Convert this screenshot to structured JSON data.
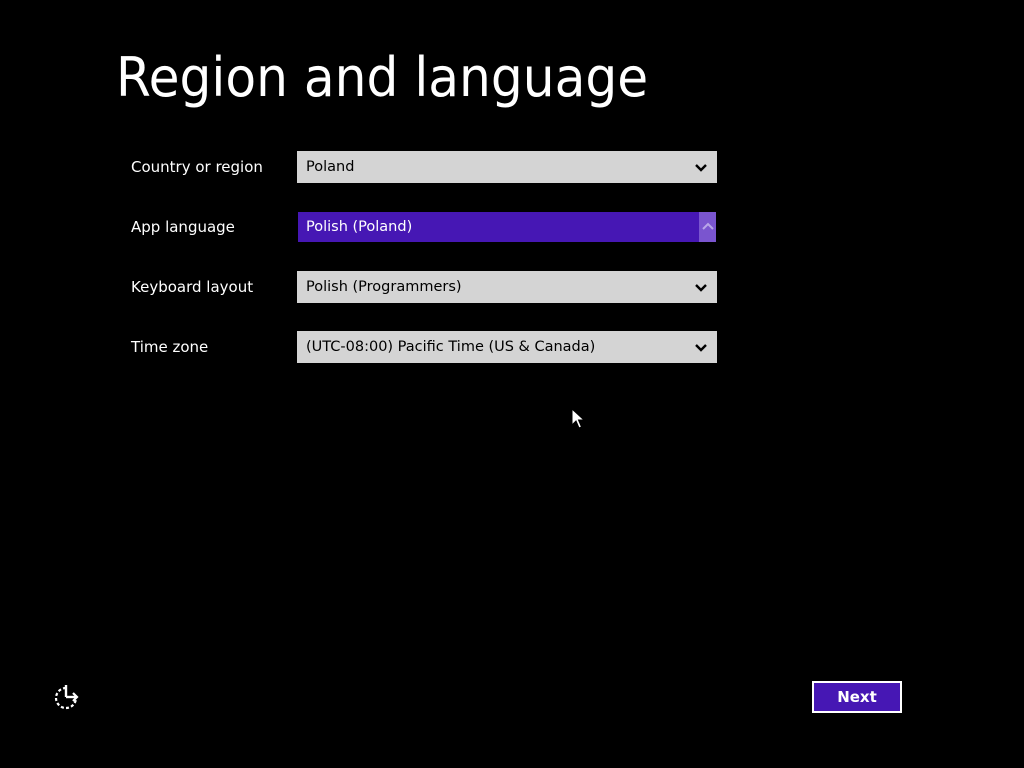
{
  "page": {
    "title": "Region and language"
  },
  "fields": [
    {
      "label": "Country or region",
      "value": "Poland",
      "state": "collapsed",
      "icon": "chevron-down-icon"
    },
    {
      "label": "App language",
      "value": "Polish (Poland)",
      "state": "open",
      "icon": "chevron-up-icon"
    },
    {
      "label": "Keyboard layout",
      "value": "Polish (Programmers)",
      "state": "collapsed",
      "icon": "chevron-down-icon"
    },
    {
      "label": "Time zone",
      "value": "(UTC-08:00) Pacific Time (US & Canada)",
      "state": "collapsed",
      "icon": "chevron-down-icon"
    }
  ],
  "footer": {
    "ease_of_access_icon": "ease-of-access-icon",
    "next_label": "Next"
  },
  "colors": {
    "background": "#000000",
    "accent": "#4617b4",
    "accent_light": "#7a55cf",
    "select_background": "#d4d4d4",
    "text": "#ffffff"
  }
}
